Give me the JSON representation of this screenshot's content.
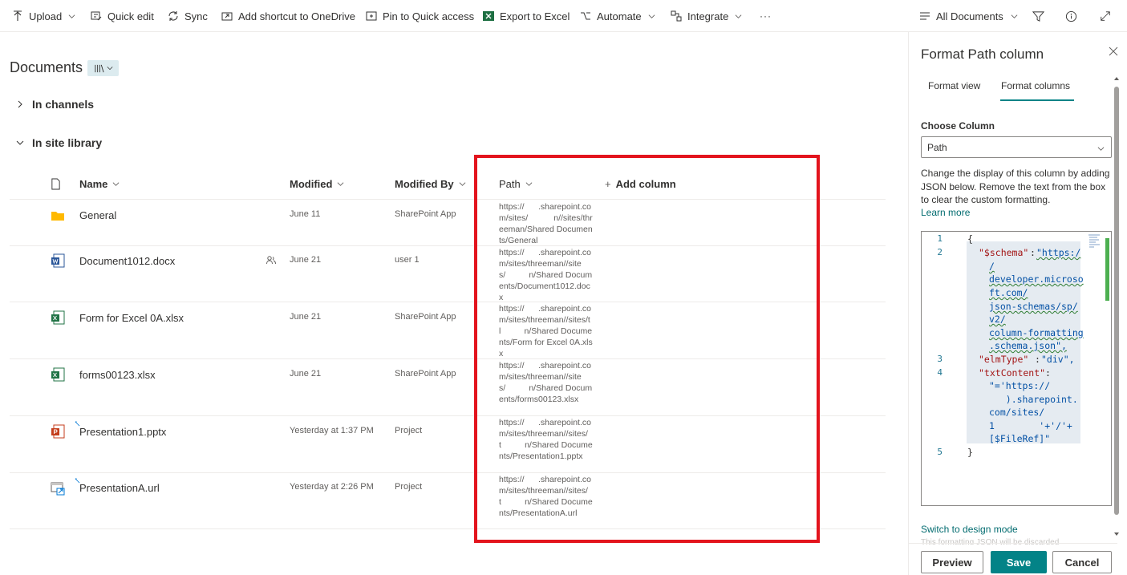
{
  "command_bar": {
    "upload": "Upload",
    "quick_edit": "Quick edit",
    "sync": "Sync",
    "add_shortcut": "Add shortcut to OneDrive",
    "pin": "Pin to Quick access",
    "export": "Export to Excel",
    "automate": "Automate",
    "integrate": "Integrate",
    "more": "···",
    "view_name": "All Documents"
  },
  "library": {
    "title": "Documents",
    "groups": {
      "channels": "In channels",
      "site_library": "In site library"
    },
    "columns": {
      "name": "Name",
      "modified": "Modified",
      "modified_by": "Modified By",
      "path": "Path",
      "add_column": "Add column"
    },
    "rows": [
      {
        "name": "General",
        "modified": "June 11",
        "modified_by": "SharePoint App",
        "path": "https://      .sharepoint.com/sites/           n//sites/threeman/Shared Documents/General",
        "type": "folder"
      },
      {
        "name": "Document1012.docx",
        "modified": "June 21",
        "modified_by": "user 1",
        "path": "https://      .sharepoint.com/sites/threeman//sites/          n/Shared Documents/Document1012.docx",
        "type": "word",
        "shared": true
      },
      {
        "name": "Form for Excel 0A.xlsx",
        "modified": "June 21",
        "modified_by": "SharePoint App",
        "path": "https://      .sharepoint.com/sites/threeman//sites/tl          n/Shared Documents/Form for Excel 0A.xlsx",
        "type": "excel"
      },
      {
        "name": "forms00123.xlsx",
        "modified": "June 21",
        "modified_by": "SharePoint App",
        "path": "https://      .sharepoint.com/sites/threeman//sites/          n/Shared Documents/forms00123.xlsx",
        "type": "excel"
      },
      {
        "name": "Presentation1.pptx",
        "modified": "Yesterday at 1:37 PM",
        "modified_by": "Project",
        "path": "https://      .sharepoint.com/sites/threeman//sites/t          n/Shared Documents/Presentation1.pptx",
        "type": "powerpoint",
        "new": true
      },
      {
        "name": "PresentationA.url",
        "modified": "Yesterday at 2:26 PM",
        "modified_by": "Project",
        "path": "https://      .sharepoint.com/sites/threeman//sites/t          n/Shared Documents/PresentationA.url",
        "type": "link",
        "new": true
      }
    ]
  },
  "panel": {
    "title": "Format Path column",
    "tabs": [
      "Format view",
      "Format columns"
    ],
    "choose_label": "Choose Column",
    "choose_value": "Path",
    "help": "Change the display of this column by adding JSON below. Remove the text from the box to clear the custom formatting.",
    "learn_more": "Learn more",
    "line_numbers": [
      "1",
      "2",
      "3",
      "4",
      "5"
    ],
    "code": {
      "l1": "{",
      "schema_key": "\"$schema\"",
      "schema_val": [
        "\"https:/",
        "/",
        "developer.microso",
        "ft.com/",
        "json-schemas/sp/",
        "v2/",
        "column-formatting",
        ".schema.json\","
      ],
      "elm_key": "\"elmType\"",
      "elm_val": "\"div\",",
      "txt_key": "\"txtContent\"",
      "txt_val": [
        "\"='https://",
        "   ).sharepoint.",
        "com/sites/",
        "1        '+'/'+",
        "[$FileRef]\""
      ],
      "l5": "}"
    },
    "switch_link": "Switch to design mode",
    "faded_text": "This formatting JSON will be discarded",
    "buttons": {
      "preview": "Preview",
      "save": "Save",
      "cancel": "Cancel"
    }
  },
  "colors": {
    "accent": "#038387",
    "highlight": "#e3141d",
    "link": "#036c70"
  }
}
